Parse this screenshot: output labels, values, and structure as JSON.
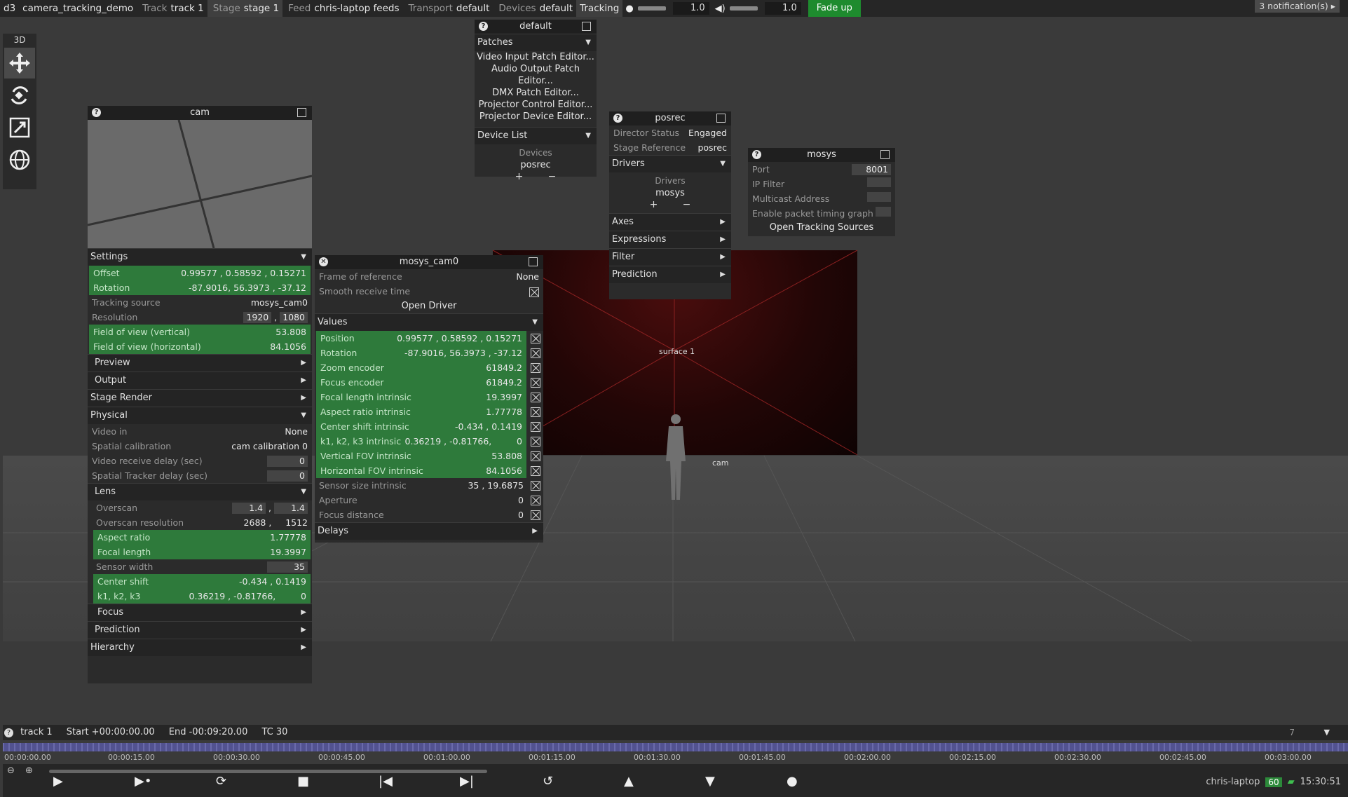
{
  "topbar": {
    "app": "d3",
    "project": "camera_tracking_demo",
    "track_key": "Track",
    "track_val": "track 1",
    "stage_key": "Stage",
    "stage_val": "stage 1",
    "feed_key": "Feed",
    "feed_val": "chris-laptop feeds",
    "transport_key": "Transport",
    "transport_val": "default",
    "devices_key": "Devices",
    "devices_val": "default",
    "tracking": "Tracking",
    "brightness": "1.0",
    "volume": "1.0",
    "fade": "Fade up",
    "notifications": "3 notification(s)"
  },
  "tools": {
    "mode": "3D"
  },
  "viewport": {
    "surface": "surface 1",
    "cam": "cam"
  },
  "cam": {
    "title": "cam",
    "settings": "Settings",
    "offset_l": "Offset",
    "offset_v": "0.99577 ,  0.58592 ,  0.15271",
    "rotation_l": "Rotation",
    "rotation_v": "-87.9016,  56.3973 ,   -37.12",
    "tracking_l": "Tracking source",
    "tracking_v": "mosys_cam0",
    "res_l": "Resolution",
    "res_w": "1920",
    "res_h": "1080",
    "fovv_l": "Field of view (vertical)",
    "fovv_v": "53.808",
    "fovh_l": "Field of view (horizontal)",
    "fovh_v": "84.1056",
    "preview": "Preview",
    "output": "Output",
    "stage_render": "Stage Render",
    "physical": "Physical",
    "videoin_l": "Video in",
    "videoin_v": "None",
    "spatial_l": "Spatial calibration",
    "spatial_v": "cam calibration 0",
    "vdelay_l": "Video receive delay (sec)",
    "vdelay_v": "0",
    "sdelay_l": "Spatial Tracker delay (sec)",
    "sdelay_v": "0",
    "lens": "Lens",
    "overscan_l": "Overscan",
    "overscan_a": "1.4",
    "overscan_b": "1.4",
    "osres_l": "Overscan resolution",
    "osres_a": "2688",
    "osres_b": "1512",
    "aspect_l": "Aspect ratio",
    "aspect_v": "1.77778",
    "focal_l": "Focal length",
    "focal_v": "19.3997",
    "sensor_l": "Sensor width",
    "sensor_v": "35",
    "cshift_l": "Center shift",
    "cshift_v": "-0.434 ,   0.1419",
    "k_l": "k1, k2, k3",
    "k_v": "0.36219 , -0.81766,         0",
    "focus": "Focus",
    "prediction": "Prediction",
    "hierarchy": "Hierarchy"
  },
  "mosys_cam0": {
    "title": "mosys_cam0",
    "frame_l": "Frame of reference",
    "frame_v": "None",
    "smooth_l": "Smooth receive time",
    "open_driver": "Open Driver",
    "values": "Values",
    "pos_l": "Position",
    "pos_v": "0.99577 ,  0.58592 ,  0.15271",
    "rot_l": "Rotation",
    "rot_v": "-87.9016,  56.3973 ,   -37.12",
    "zoom_l": "Zoom encoder",
    "zoom_v": "61849.2",
    "focus_l": "Focus encoder",
    "focus_v": "61849.2",
    "fli_l": "Focal length intrinsic",
    "fli_v": "19.3997",
    "ari_l": "Aspect ratio intrinsic",
    "ari_v": "1.77778",
    "csi_l": "Center shift intrinsic",
    "csi_v": "-0.434 ,   0.1419",
    "ki_l": "k1, k2, k3 intrinsic",
    "ki_v": "0.36219 , -0.81766,         0",
    "vfov_l": "Vertical FOV intrinsic",
    "vfov_v": "53.808",
    "hfov_l": "Horizontal FOV intrinsic",
    "hfov_v": "84.1056",
    "ssi_l": "Sensor size intrinsic",
    "ssi_v": "35 ,  19.6875",
    "ap_l": "Aperture",
    "ap_v": "0",
    "fd_l": "Focus distance",
    "fd_v": "0",
    "delays": "Delays"
  },
  "default_panel": {
    "title": "default",
    "patches": "Patches",
    "items": [
      "Video Input Patch Editor...",
      "Audio Output Patch Editor...",
      "DMX Patch Editor...",
      "Projector Control Editor...",
      "Projector Device Editor..."
    ],
    "device_list": "Device List",
    "devices_l": "Devices",
    "devices_v": "posrec"
  },
  "posrec": {
    "title": "posrec",
    "director_l": "Director Status",
    "director_v": "Engaged",
    "stageref_l": "Stage Reference",
    "stageref_v": "posrec",
    "drivers": "Drivers",
    "drivers_l": "Drivers",
    "drivers_v": "mosys",
    "axes": "Axes",
    "expressions": "Expressions",
    "filter": "Filter",
    "prediction": "Prediction"
  },
  "mosys": {
    "title": "mosys",
    "port_l": "Port",
    "port_v": "8001",
    "ipfilter_l": "IP Filter",
    "multicast_l": "Multicast Address",
    "packet_l": "Enable packet timing graph",
    "open": "Open Tracking Sources"
  },
  "timeline": {
    "track": "track 1",
    "start": "Start +00:00:00.00",
    "end": "End -00:09:20.00",
    "tc": "TC 30",
    "ticks": [
      "00:00:00.00",
      "00:00:15.00",
      "00:00:30.00",
      "00:00:45.00",
      "00:01:00.00",
      "00:01:15.00",
      "00:01:30.00",
      "00:01:45.00",
      "00:02:00.00",
      "00:02:15.00",
      "00:02:30.00",
      "00:02:45.00",
      "00:03:00.00"
    ],
    "layers_count": "7"
  },
  "status": {
    "machine": "chris-laptop",
    "fps": "60",
    "time": "15:30:51"
  }
}
